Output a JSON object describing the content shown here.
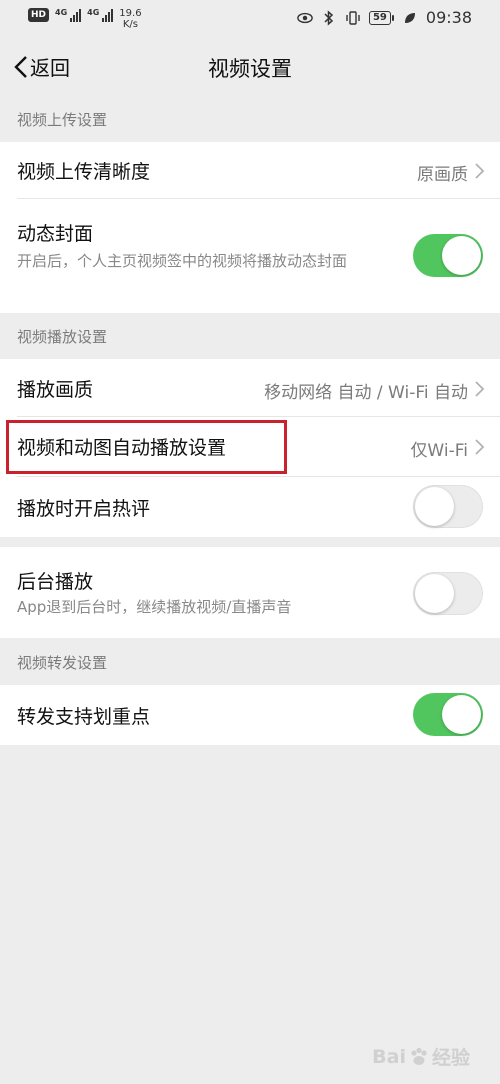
{
  "status_bar": {
    "hd": "HD",
    "sim1_net": "4G",
    "sim2_net": "4G",
    "speed_value": "19.6",
    "speed_unit": "K/s",
    "battery": "59",
    "time": "09:38"
  },
  "nav": {
    "back_label": "返回",
    "title": "视频设置"
  },
  "sections": {
    "upload": {
      "header": "视频上传设置",
      "quality": {
        "title": "视频上传清晰度",
        "value": "原画质"
      },
      "dynamic_cover": {
        "title": "动态封面",
        "subtitle": "开启后，个人主页视频签中的视频将播放动态封面",
        "enabled": true
      }
    },
    "playback": {
      "header": "视频播放设置",
      "quality": {
        "title": "播放画质",
        "value": "移动网络 自动 / Wi-Fi 自动"
      },
      "autoplay": {
        "title": "视频和动图自动播放设置",
        "value": "仅Wi-Fi"
      },
      "hot_comments": {
        "title": "播放时开启热评",
        "enabled": false
      },
      "background": {
        "title": "后台播放",
        "subtitle": "App退到后台时，继续播放视频/直播声音",
        "enabled": false
      }
    },
    "forward": {
      "header": "视频转发设置",
      "highlight": {
        "title": "转发支持划重点",
        "enabled": true
      }
    }
  },
  "colors": {
    "toggle_on": "#51c65f",
    "highlight_box": "#c8232c"
  },
  "watermark": {
    "brand_left": "Bai",
    "brand_right": "经验"
  }
}
